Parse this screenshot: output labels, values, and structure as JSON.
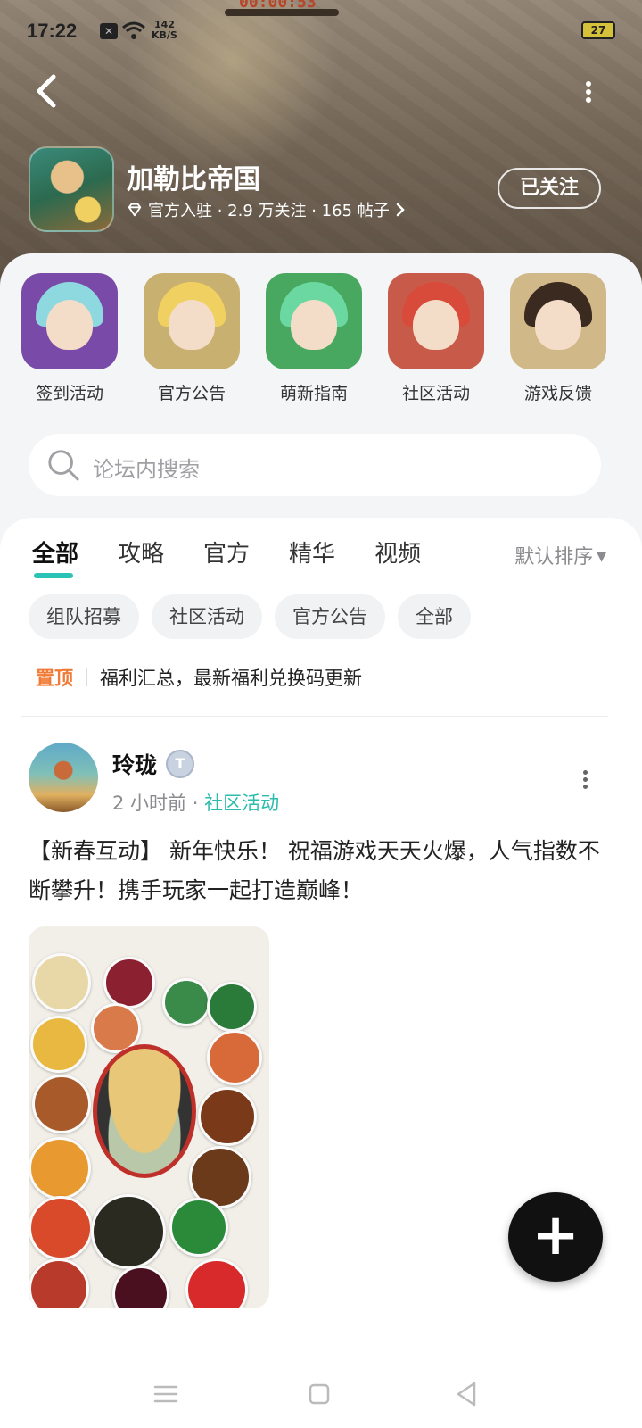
{
  "status_bar": {
    "time": "17:22",
    "net_speed_value": "142",
    "net_speed_unit": "KB/S",
    "battery": "27"
  },
  "game_timer": "00:00:53",
  "header": {
    "title": "加勒比帝国",
    "meta": "官方入驻 · 2.9 万关注 · 165 帖子",
    "follow_label": "已关注"
  },
  "shortcuts": [
    {
      "label": "签到活动",
      "hair": "#8ed8e0",
      "bg": "#7a4aa8"
    },
    {
      "label": "官方公告",
      "hair": "#f0d060",
      "bg": "#c8b070"
    },
    {
      "label": "萌新指南",
      "hair": "#6ad8a0",
      "bg": "#48a860"
    },
    {
      "label": "社区活动",
      "hair": "#d84a3a",
      "bg": "#c85a4a"
    },
    {
      "label": "游戏反馈",
      "hair": "#3a2a20",
      "bg": "#d0b888"
    }
  ],
  "search": {
    "placeholder": "论坛内搜索"
  },
  "tabs": [
    "全部",
    "攻略",
    "官方",
    "精华",
    "视频"
  ],
  "sort_label": "默认排序",
  "chips": [
    "组队招募",
    "社区活动",
    "官方公告",
    "全部"
  ],
  "pinned": {
    "tag": "置顶",
    "title": "福利汇总，最新福利兑换码更新"
  },
  "post": {
    "author": "玲珑",
    "time": "2 小时前",
    "separator": "·",
    "category": "社区活动",
    "text": "【新春互动】 新年快乐！ 祝福游戏天天火爆，人气指数不断攀升！携手玩家一起打造巅峰！"
  },
  "colors": {
    "accent": "#2bc3b5",
    "pin": "#f07a36"
  }
}
